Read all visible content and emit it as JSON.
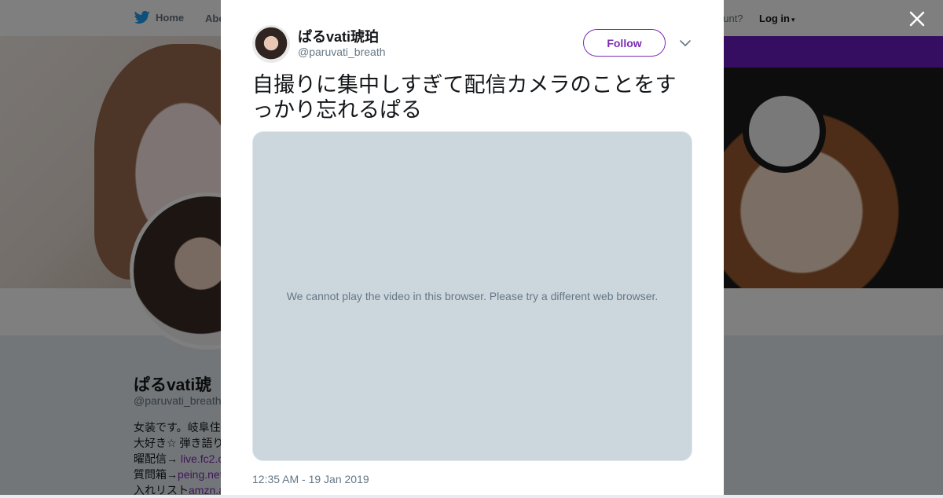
{
  "nav": {
    "home_label": "Home",
    "about_label": "Abo",
    "account_prompt": "ccount?",
    "login_label": "Log in"
  },
  "profile": {
    "name": "ぱるvati琥",
    "handle": "@paruvati_breath",
    "bio": [
      {
        "text": "女装です。岐阜住",
        "link": ""
      },
      {
        "text": "大好き☆ 弾き語り",
        "link": ""
      },
      {
        "text": "曜配信→ ",
        "link": "live.fc2.c"
      },
      {
        "text": "質問箱→",
        "link": "peing.net"
      },
      {
        "text": "入れリスト",
        "link": "amzn.a"
      }
    ]
  },
  "tweet": {
    "author_name": "ぱるvati琥珀",
    "author_handle": "@paruvati_breath",
    "follow_label": "Follow",
    "text": "自撮りに集中しすぎて配信カメラのことをすっかり忘れるぱる",
    "video_message": "We cannot play the video in this browser. Please try a different web browser.",
    "timestamp": "12:35 AM - 19 Jan 2019"
  },
  "colors": {
    "accent": "#7b2ab3",
    "twitter_blue": "#1da1f2",
    "video_bg": "#ccd6dd",
    "muted_text": "#657786"
  },
  "icons": {
    "home": "twitter-bird-icon",
    "close": "close-icon",
    "more": "chevron-down-icon"
  }
}
